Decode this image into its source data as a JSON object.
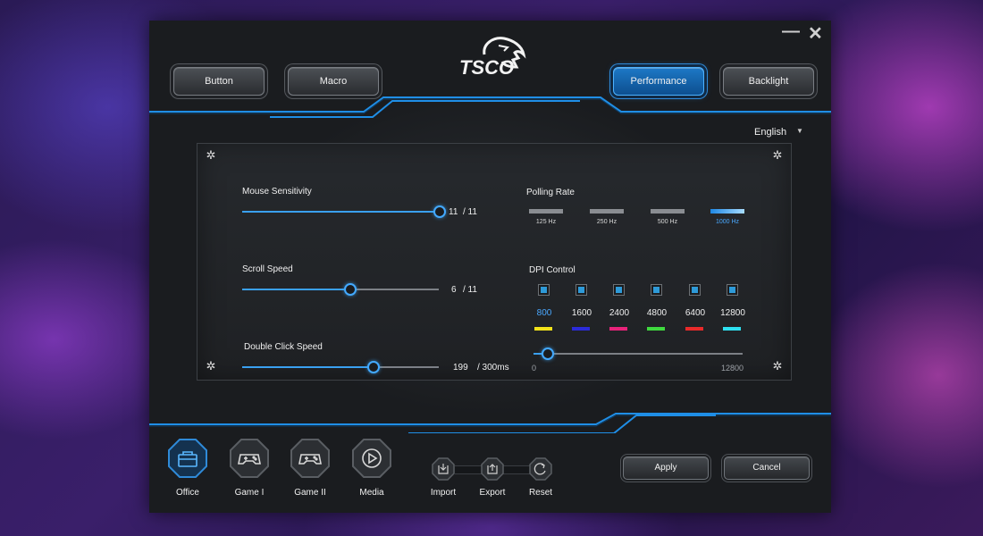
{
  "window": {
    "minimize_label": "—",
    "close_label": "✕"
  },
  "tabs": [
    {
      "label": "Button",
      "active": false
    },
    {
      "label": "Macro",
      "active": false
    },
    {
      "label": "Performance",
      "active": true
    },
    {
      "label": "Backlight",
      "active": false
    }
  ],
  "logo": {
    "text": "TSCO",
    "icon": "lion-head-logo"
  },
  "language": {
    "selected": "English",
    "icon": "caret-down-icon"
  },
  "performance": {
    "mouse_sensitivity": {
      "label": "Mouse Sensitivity",
      "value": 11,
      "max": 11,
      "value_text": "11",
      "max_text": "/ 11"
    },
    "scroll_speed": {
      "label": "Scroll Speed",
      "value": 6,
      "max": 11,
      "value_text": "6",
      "max_text": "/ 11"
    },
    "double_click_speed": {
      "label": "Double Click Speed",
      "value": 199,
      "max": 300,
      "value_text": "199",
      "max_text": "/ 300ms"
    },
    "polling_rate": {
      "label": "Polling Rate",
      "options": [
        "125 Hz",
        "250 Hz",
        "500 Hz",
        "1000 Hz"
      ],
      "selected": "1000 Hz"
    },
    "dpi_control": {
      "label": "DPI Control",
      "levels": [
        {
          "value": "800",
          "color": "#f2e21a",
          "enabled": true,
          "active": true
        },
        {
          "value": "1600",
          "color": "#2b2bd8",
          "enabled": true,
          "active": false
        },
        {
          "value": "2400",
          "color": "#e8237a",
          "enabled": true,
          "active": false
        },
        {
          "value": "4800",
          "color": "#3fd93f",
          "enabled": true,
          "active": false
        },
        {
          "value": "6400",
          "color": "#e82a2a",
          "enabled": true,
          "active": false
        },
        {
          "value": "12800",
          "color": "#2ee0f0",
          "enabled": true,
          "active": false
        }
      ],
      "slider_min": "0",
      "slider_max": "12800",
      "slider_value": 800
    }
  },
  "modes": [
    {
      "label": "Office",
      "icon": "toolbox-icon",
      "active": true
    },
    {
      "label": "Game I",
      "icon": "gamepad-icon",
      "active": false
    },
    {
      "label": "Game II",
      "icon": "gamepad-icon",
      "active": false
    },
    {
      "label": "Media",
      "icon": "play-icon",
      "active": false
    }
  ],
  "tools": [
    {
      "label": "Import",
      "icon": "import-icon"
    },
    {
      "label": "Export",
      "icon": "export-icon"
    },
    {
      "label": "Reset",
      "icon": "reset-icon"
    }
  ],
  "actions": {
    "apply": "Apply",
    "cancel": "Cancel"
  },
  "colors": {
    "accent": "#3aa0f0",
    "background": "#1f2124"
  }
}
